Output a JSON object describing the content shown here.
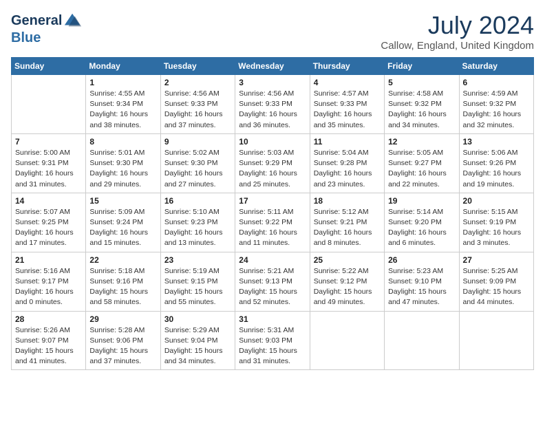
{
  "header": {
    "logo_line1": "General",
    "logo_line2": "Blue",
    "month_year": "July 2024",
    "location": "Callow, England, United Kingdom"
  },
  "weekdays": [
    "Sunday",
    "Monday",
    "Tuesday",
    "Wednesday",
    "Thursday",
    "Friday",
    "Saturday"
  ],
  "weeks": [
    [
      {
        "day": "",
        "info": ""
      },
      {
        "day": "1",
        "info": "Sunrise: 4:55 AM\nSunset: 9:34 PM\nDaylight: 16 hours\nand 38 minutes."
      },
      {
        "day": "2",
        "info": "Sunrise: 4:56 AM\nSunset: 9:33 PM\nDaylight: 16 hours\nand 37 minutes."
      },
      {
        "day": "3",
        "info": "Sunrise: 4:56 AM\nSunset: 9:33 PM\nDaylight: 16 hours\nand 36 minutes."
      },
      {
        "day": "4",
        "info": "Sunrise: 4:57 AM\nSunset: 9:33 PM\nDaylight: 16 hours\nand 35 minutes."
      },
      {
        "day": "5",
        "info": "Sunrise: 4:58 AM\nSunset: 9:32 PM\nDaylight: 16 hours\nand 34 minutes."
      },
      {
        "day": "6",
        "info": "Sunrise: 4:59 AM\nSunset: 9:32 PM\nDaylight: 16 hours\nand 32 minutes."
      }
    ],
    [
      {
        "day": "7",
        "info": "Sunrise: 5:00 AM\nSunset: 9:31 PM\nDaylight: 16 hours\nand 31 minutes."
      },
      {
        "day": "8",
        "info": "Sunrise: 5:01 AM\nSunset: 9:30 PM\nDaylight: 16 hours\nand 29 minutes."
      },
      {
        "day": "9",
        "info": "Sunrise: 5:02 AM\nSunset: 9:30 PM\nDaylight: 16 hours\nand 27 minutes."
      },
      {
        "day": "10",
        "info": "Sunrise: 5:03 AM\nSunset: 9:29 PM\nDaylight: 16 hours\nand 25 minutes."
      },
      {
        "day": "11",
        "info": "Sunrise: 5:04 AM\nSunset: 9:28 PM\nDaylight: 16 hours\nand 23 minutes."
      },
      {
        "day": "12",
        "info": "Sunrise: 5:05 AM\nSunset: 9:27 PM\nDaylight: 16 hours\nand 22 minutes."
      },
      {
        "day": "13",
        "info": "Sunrise: 5:06 AM\nSunset: 9:26 PM\nDaylight: 16 hours\nand 19 minutes."
      }
    ],
    [
      {
        "day": "14",
        "info": "Sunrise: 5:07 AM\nSunset: 9:25 PM\nDaylight: 16 hours\nand 17 minutes."
      },
      {
        "day": "15",
        "info": "Sunrise: 5:09 AM\nSunset: 9:24 PM\nDaylight: 16 hours\nand 15 minutes."
      },
      {
        "day": "16",
        "info": "Sunrise: 5:10 AM\nSunset: 9:23 PM\nDaylight: 16 hours\nand 13 minutes."
      },
      {
        "day": "17",
        "info": "Sunrise: 5:11 AM\nSunset: 9:22 PM\nDaylight: 16 hours\nand 11 minutes."
      },
      {
        "day": "18",
        "info": "Sunrise: 5:12 AM\nSunset: 9:21 PM\nDaylight: 16 hours\nand 8 minutes."
      },
      {
        "day": "19",
        "info": "Sunrise: 5:14 AM\nSunset: 9:20 PM\nDaylight: 16 hours\nand 6 minutes."
      },
      {
        "day": "20",
        "info": "Sunrise: 5:15 AM\nSunset: 9:19 PM\nDaylight: 16 hours\nand 3 minutes."
      }
    ],
    [
      {
        "day": "21",
        "info": "Sunrise: 5:16 AM\nSunset: 9:17 PM\nDaylight: 16 hours\nand 0 minutes."
      },
      {
        "day": "22",
        "info": "Sunrise: 5:18 AM\nSunset: 9:16 PM\nDaylight: 15 hours\nand 58 minutes."
      },
      {
        "day": "23",
        "info": "Sunrise: 5:19 AM\nSunset: 9:15 PM\nDaylight: 15 hours\nand 55 minutes."
      },
      {
        "day": "24",
        "info": "Sunrise: 5:21 AM\nSunset: 9:13 PM\nDaylight: 15 hours\nand 52 minutes."
      },
      {
        "day": "25",
        "info": "Sunrise: 5:22 AM\nSunset: 9:12 PM\nDaylight: 15 hours\nand 49 minutes."
      },
      {
        "day": "26",
        "info": "Sunrise: 5:23 AM\nSunset: 9:10 PM\nDaylight: 15 hours\nand 47 minutes."
      },
      {
        "day": "27",
        "info": "Sunrise: 5:25 AM\nSunset: 9:09 PM\nDaylight: 15 hours\nand 44 minutes."
      }
    ],
    [
      {
        "day": "28",
        "info": "Sunrise: 5:26 AM\nSunset: 9:07 PM\nDaylight: 15 hours\nand 41 minutes."
      },
      {
        "day": "29",
        "info": "Sunrise: 5:28 AM\nSunset: 9:06 PM\nDaylight: 15 hours\nand 37 minutes."
      },
      {
        "day": "30",
        "info": "Sunrise: 5:29 AM\nSunset: 9:04 PM\nDaylight: 15 hours\nand 34 minutes."
      },
      {
        "day": "31",
        "info": "Sunrise: 5:31 AM\nSunset: 9:03 PM\nDaylight: 15 hours\nand 31 minutes."
      },
      {
        "day": "",
        "info": ""
      },
      {
        "day": "",
        "info": ""
      },
      {
        "day": "",
        "info": ""
      }
    ]
  ]
}
